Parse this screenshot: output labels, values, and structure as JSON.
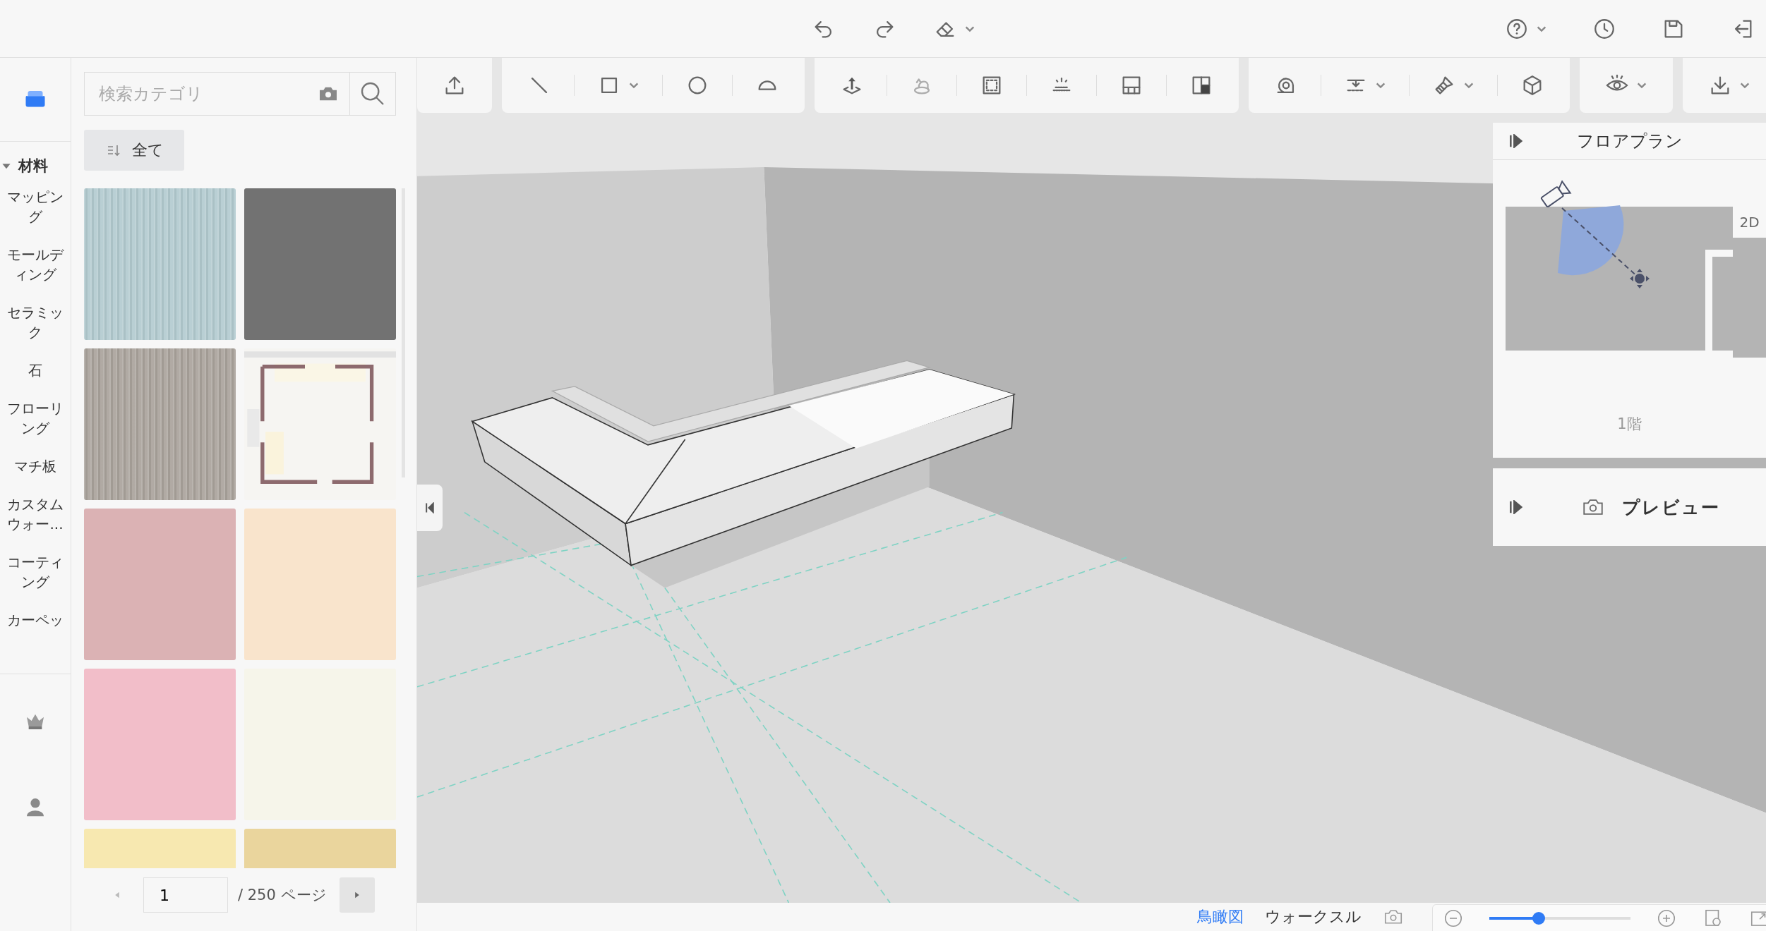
{
  "top_bar": {
    "center_tools": [
      {
        "kind": "undo",
        "caret": false
      },
      {
        "kind": "redo",
        "caret": false
      },
      {
        "kind": "eraser",
        "caret": true
      }
    ],
    "right_tools": [
      {
        "kind": "help",
        "caret": true
      },
      {
        "kind": "history",
        "caret": false
      },
      {
        "kind": "save",
        "caret": false
      },
      {
        "kind": "exit",
        "caret": false
      }
    ]
  },
  "nav": {
    "section": {
      "label": "材料",
      "expanded": true
    },
    "items": [
      "マッピング",
      "モールディング",
      "セラミック",
      "石",
      "フローリング",
      "マチ板",
      "カスタムウォー...",
      "コーティング",
      "カーペッ"
    ],
    "bottom_icons": [
      {
        "kind": "crown"
      },
      {
        "kind": "user"
      }
    ]
  },
  "materials": {
    "search": {
      "placeholder": "検索カテゴリ"
    },
    "filter": "全て",
    "swatches": [
      {
        "kind": "texture",
        "color": "#b3cbd0"
      },
      {
        "kind": "color",
        "color": "#727272"
      },
      {
        "kind": "texture",
        "color": "#aaa39c"
      },
      {
        "kind": "picture"
      },
      {
        "kind": "color",
        "color": "#dbb2b4"
      },
      {
        "kind": "color",
        "color": "#f9e4cc"
      },
      {
        "kind": "color",
        "color": "#f2bec9"
      },
      {
        "kind": "color",
        "color": "#f6f5ea"
      },
      {
        "kind": "color",
        "color": "#f7e8b0"
      },
      {
        "kind": "color",
        "color": "#ead59d"
      }
    ],
    "pagination": {
      "page": "1",
      "total": "/ 250 ページ"
    }
  },
  "toolbar": {
    "groups": [
      {
        "tools": [
          {
            "kind": "upload",
            "caret": false,
            "disabled": false
          }
        ]
      },
      {
        "tools": [
          {
            "kind": "line",
            "caret": false,
            "disabled": false
          },
          {
            "kind": "rect",
            "caret": true,
            "disabled": false
          },
          {
            "kind": "circle",
            "caret": false,
            "disabled": false
          },
          {
            "kind": "arc",
            "caret": false,
            "disabled": false
          }
        ]
      },
      {
        "tools": [
          {
            "kind": "moveup",
            "caret": false,
            "disabled": false
          },
          {
            "kind": "rotate",
            "caret": false,
            "disabled": true
          },
          {
            "kind": "selectbox",
            "caret": false,
            "disabled": false
          },
          {
            "kind": "light",
            "caret": false,
            "disabled": false
          },
          {
            "kind": "panel-bottom",
            "caret": false,
            "disabled": false
          },
          {
            "kind": "panel-corner",
            "caret": false,
            "disabled": false
          }
        ]
      },
      {
        "tools": [
          {
            "kind": "tape",
            "caret": false,
            "disabled": false
          },
          {
            "kind": "level",
            "caret": true,
            "disabled": false
          },
          {
            "kind": "brush",
            "caret": true,
            "disabled": false
          },
          {
            "kind": "cube",
            "caret": false,
            "disabled": false
          }
        ]
      },
      {
        "tools": [
          {
            "kind": "eye",
            "caret": true,
            "disabled": false
          }
        ]
      },
      {
        "tools": [
          {
            "kind": "download",
            "caret": true,
            "disabled": false
          }
        ]
      }
    ]
  },
  "floor_plan": {
    "title": "フロアプラン",
    "mode": "2D",
    "floor": "1階"
  },
  "preview": {
    "title": "プレビュー"
  },
  "view_bar": {
    "tabs": [
      {
        "label": "鳥瞰図",
        "selected": true
      },
      {
        "label": "ウォークスル",
        "selected": false
      }
    ],
    "zoom": {
      "level": 0.35
    }
  }
}
